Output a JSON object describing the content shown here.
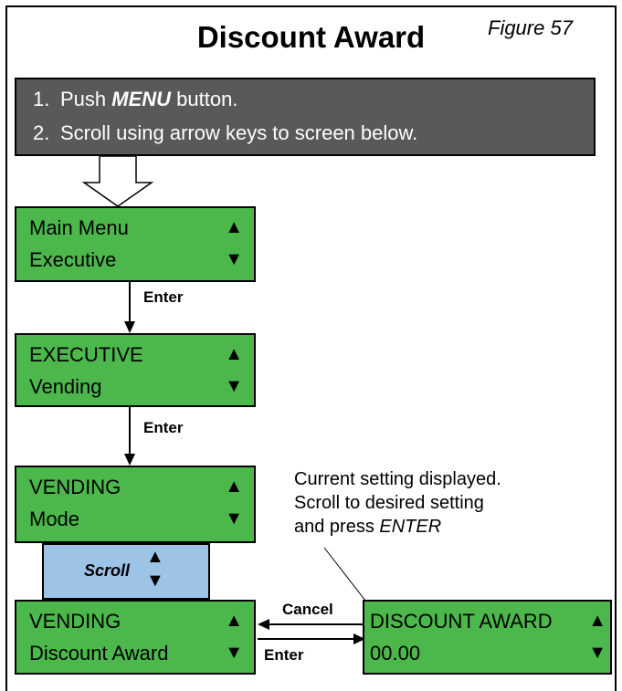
{
  "title": "Discount Award",
  "figure": "Figure 57",
  "instructions": {
    "step1_num": "1.",
    "step1_pre": "Push ",
    "step1_key": "MENU",
    "step1_post": " button.",
    "step2_num": "2.",
    "step2": "Scroll using arrow keys to screen below."
  },
  "screens": {
    "main": {
      "line1": "Main Menu",
      "line2": "Executive"
    },
    "executive": {
      "line1": "EXECUTIVE",
      "line2": "Vending"
    },
    "vending_mode": {
      "line1": "VENDING",
      "line2": "Mode"
    },
    "vending_discount": {
      "line1": "VENDING",
      "line2": "Discount Award"
    },
    "discount_award": {
      "line1": "DISCOUNT AWARD",
      "line2": "00.00"
    }
  },
  "arrows": {
    "up": "▲",
    "down": "▼"
  },
  "labels": {
    "enter1": "Enter",
    "enter2": "Enter",
    "enter3": "Enter",
    "cancel": "Cancel",
    "scroll": "Scroll"
  },
  "note": {
    "line1": "Current setting displayed.",
    "line2": "Scroll to desired setting",
    "line3_pre": "and press ",
    "line3_key": "ENTER"
  },
  "colors": {
    "lcd": "#4cb84c",
    "instructions": "#595959",
    "scroll": "#9dc3e6"
  }
}
